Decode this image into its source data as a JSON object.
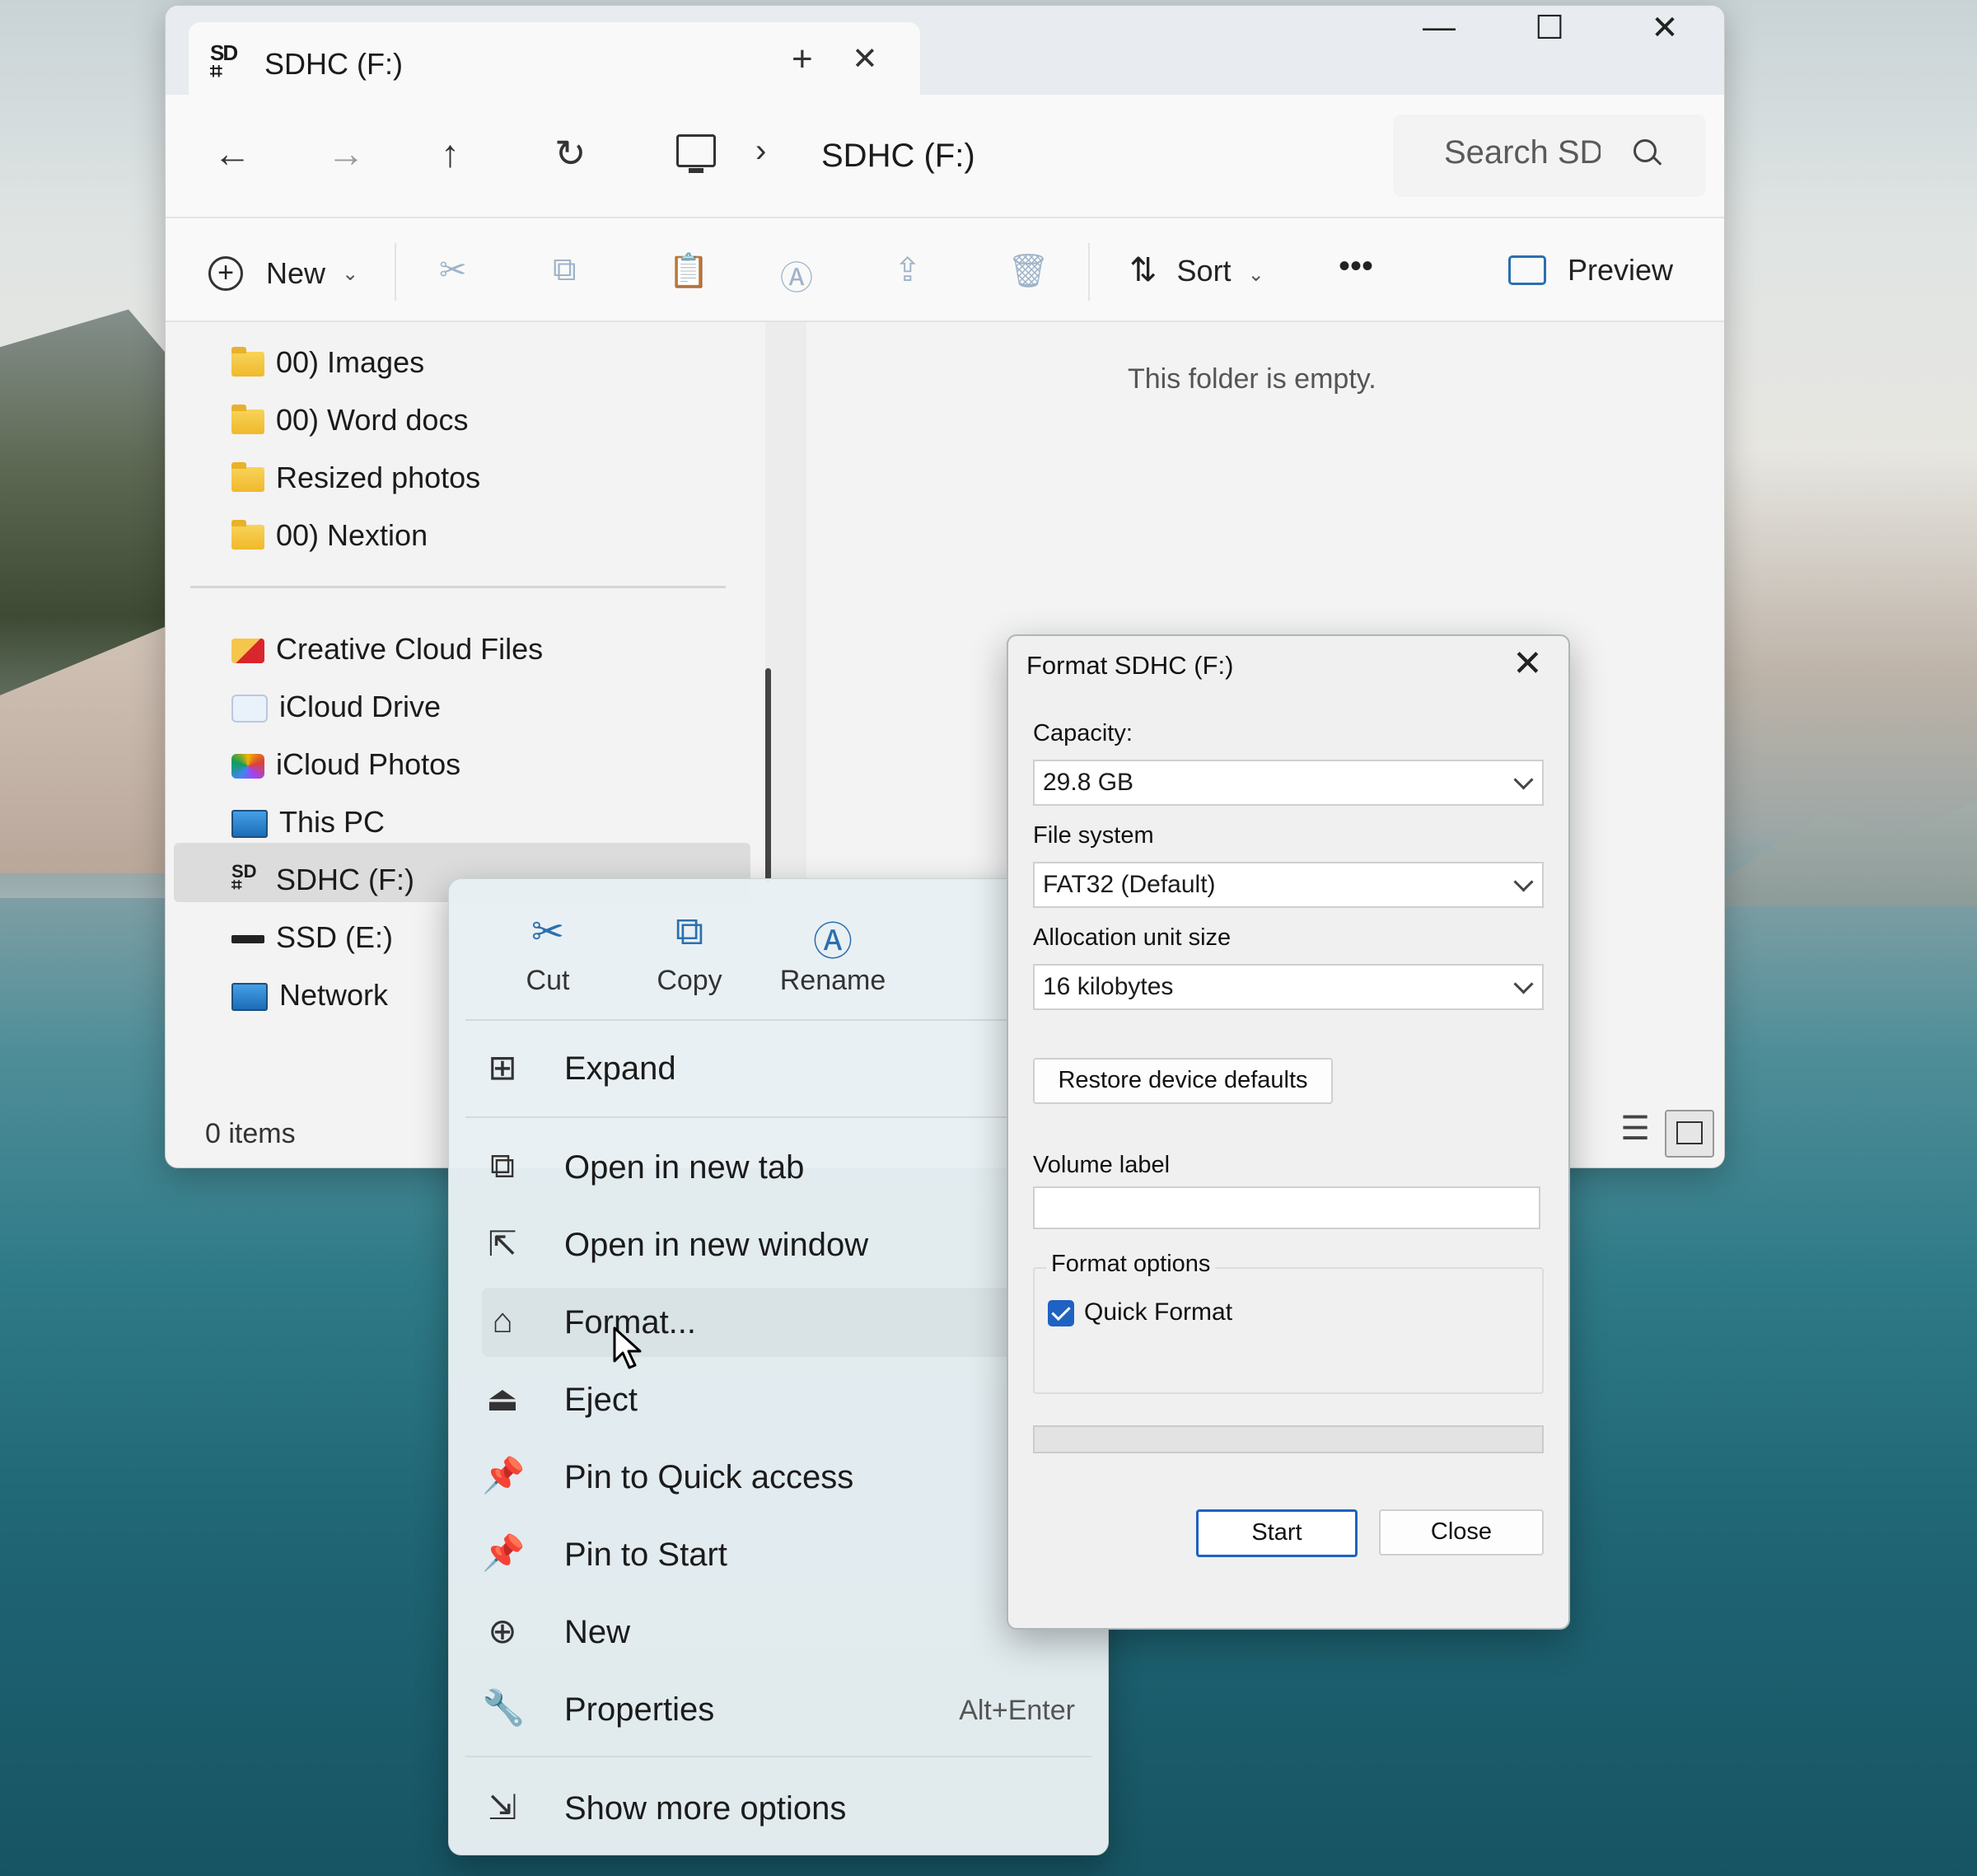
{
  "window": {
    "tab_title": "SDHC (F:)",
    "tab_icon_text": "SD",
    "address": "SDHC (F:)",
    "search_placeholder": "Search SD"
  },
  "commandbar": {
    "new_label": "New",
    "sort_label": "Sort",
    "more_label": "•••",
    "preview_label": "Preview"
  },
  "sidebar": {
    "items": [
      {
        "label": "00) Images",
        "icon": "folder-icon"
      },
      {
        "label": "00) Word docs",
        "icon": "folder-icon"
      },
      {
        "label": "Resized photos",
        "icon": "folder-icon"
      },
      {
        "label": "00) Nextion",
        "icon": "folder-icon"
      },
      {
        "label": "Creative Cloud Files",
        "icon": "creative-cloud-icon"
      },
      {
        "label": "iCloud Drive",
        "icon": "icloud-drive-icon"
      },
      {
        "label": "iCloud Photos",
        "icon": "icloud-photos-icon"
      },
      {
        "label": "This PC",
        "icon": "pc-icon"
      },
      {
        "label": "SDHC (F:)",
        "icon": "sd-card-icon"
      },
      {
        "label": "SSD (E:)",
        "icon": "drive-icon"
      },
      {
        "label": "Network",
        "icon": "network-icon"
      }
    ],
    "selected": "SDHC (F:)"
  },
  "content": {
    "empty_message": "This folder is empty."
  },
  "status": {
    "items_count": "0 items"
  },
  "context_menu": {
    "quick_actions": [
      {
        "label": "Cut",
        "icon": "cut-icon"
      },
      {
        "label": "Copy",
        "icon": "copy-icon"
      },
      {
        "label": "Rename",
        "icon": "rename-icon"
      }
    ],
    "items": [
      {
        "label": "Expand",
        "icon": "expand-icon"
      },
      {
        "label": "Open in new tab",
        "icon": "new-tab-icon"
      },
      {
        "label": "Open in new window",
        "icon": "new-window-icon"
      },
      {
        "label": "Format...",
        "icon": "format-icon"
      },
      {
        "label": "Eject",
        "icon": "eject-icon"
      },
      {
        "label": "Pin to Quick access",
        "icon": "pin-icon"
      },
      {
        "label": "Pin to Start",
        "icon": "pin-icon"
      },
      {
        "label": "New",
        "icon": "plus-icon"
      },
      {
        "label": "Properties",
        "icon": "wrench-icon",
        "shortcut": "Alt+Enter"
      },
      {
        "label": "Show more options",
        "icon": "more-options-icon"
      }
    ]
  },
  "format_dialog": {
    "title": "Format SDHC (F:)",
    "capacity_label": "Capacity:",
    "capacity_value": "29.8 GB",
    "file_system_label": "File system",
    "file_system_value": "FAT32 (Default)",
    "allocation_label": "Allocation unit size",
    "allocation_value": "16 kilobytes",
    "restore_button": "Restore device defaults",
    "volume_label": "Volume label",
    "volume_value": "",
    "format_options_label": "Format options",
    "quick_format_label": "Quick Format",
    "quick_format_checked": true,
    "progress": 0,
    "start_button": "Start",
    "close_button": "Close"
  },
  "colors": {
    "accent": "#1f62c4",
    "folder": "#f0b92b",
    "icon_blue": "#2b6fb0"
  }
}
